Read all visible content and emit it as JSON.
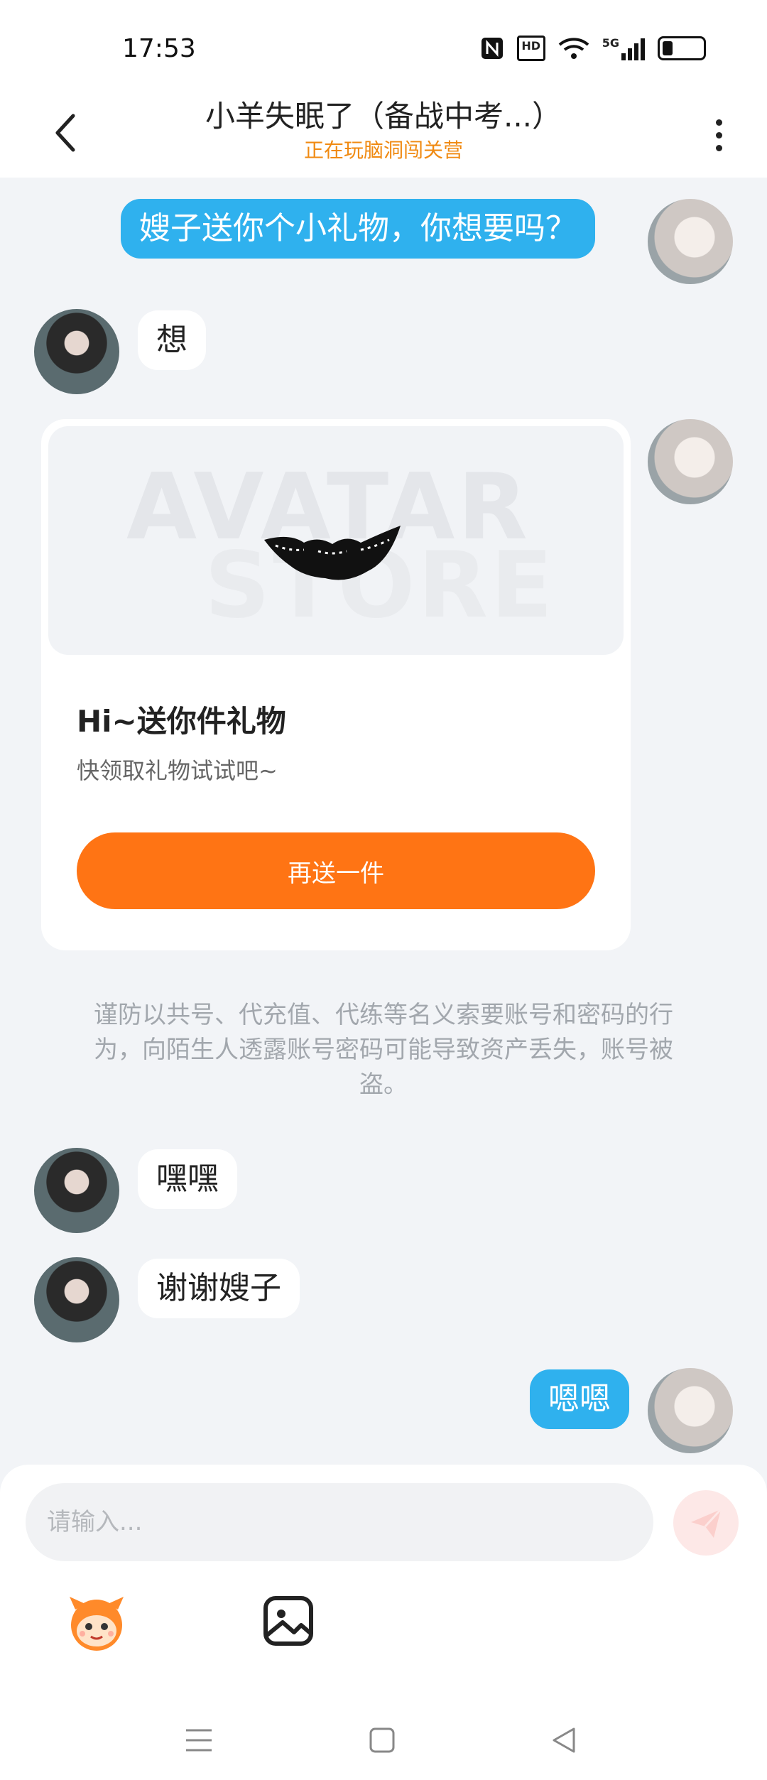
{
  "status_bar": {
    "time": "17:53",
    "hd_label": "HD",
    "network": "5G"
  },
  "header": {
    "title": "小羊失眠了（备战中考...）",
    "subtitle": "正在玩脑洞闯关营"
  },
  "messages": {
    "m1": "嫂子送你个小礼物，你想要吗？",
    "m2": "想",
    "m3": "嘿嘿",
    "m4": "谢谢嫂子",
    "m5": "嗯嗯"
  },
  "gift_card": {
    "watermark_line1": "AVATAR",
    "watermark_line2": "STORE",
    "title": "Hi~送你件礼物",
    "description": "快领取礼物试试吧~",
    "button_label": "再送一件"
  },
  "notice": "谨防以共号、代充值、代练等名义索要账号和密码的行为，向陌生人透露账号密码可能导致资产丢失，账号被盗。",
  "input": {
    "placeholder": "请输入..."
  },
  "colors": {
    "bubble_me": "#2fb1ee",
    "accent": "#ff7414",
    "subtitle": "#f08a12"
  }
}
